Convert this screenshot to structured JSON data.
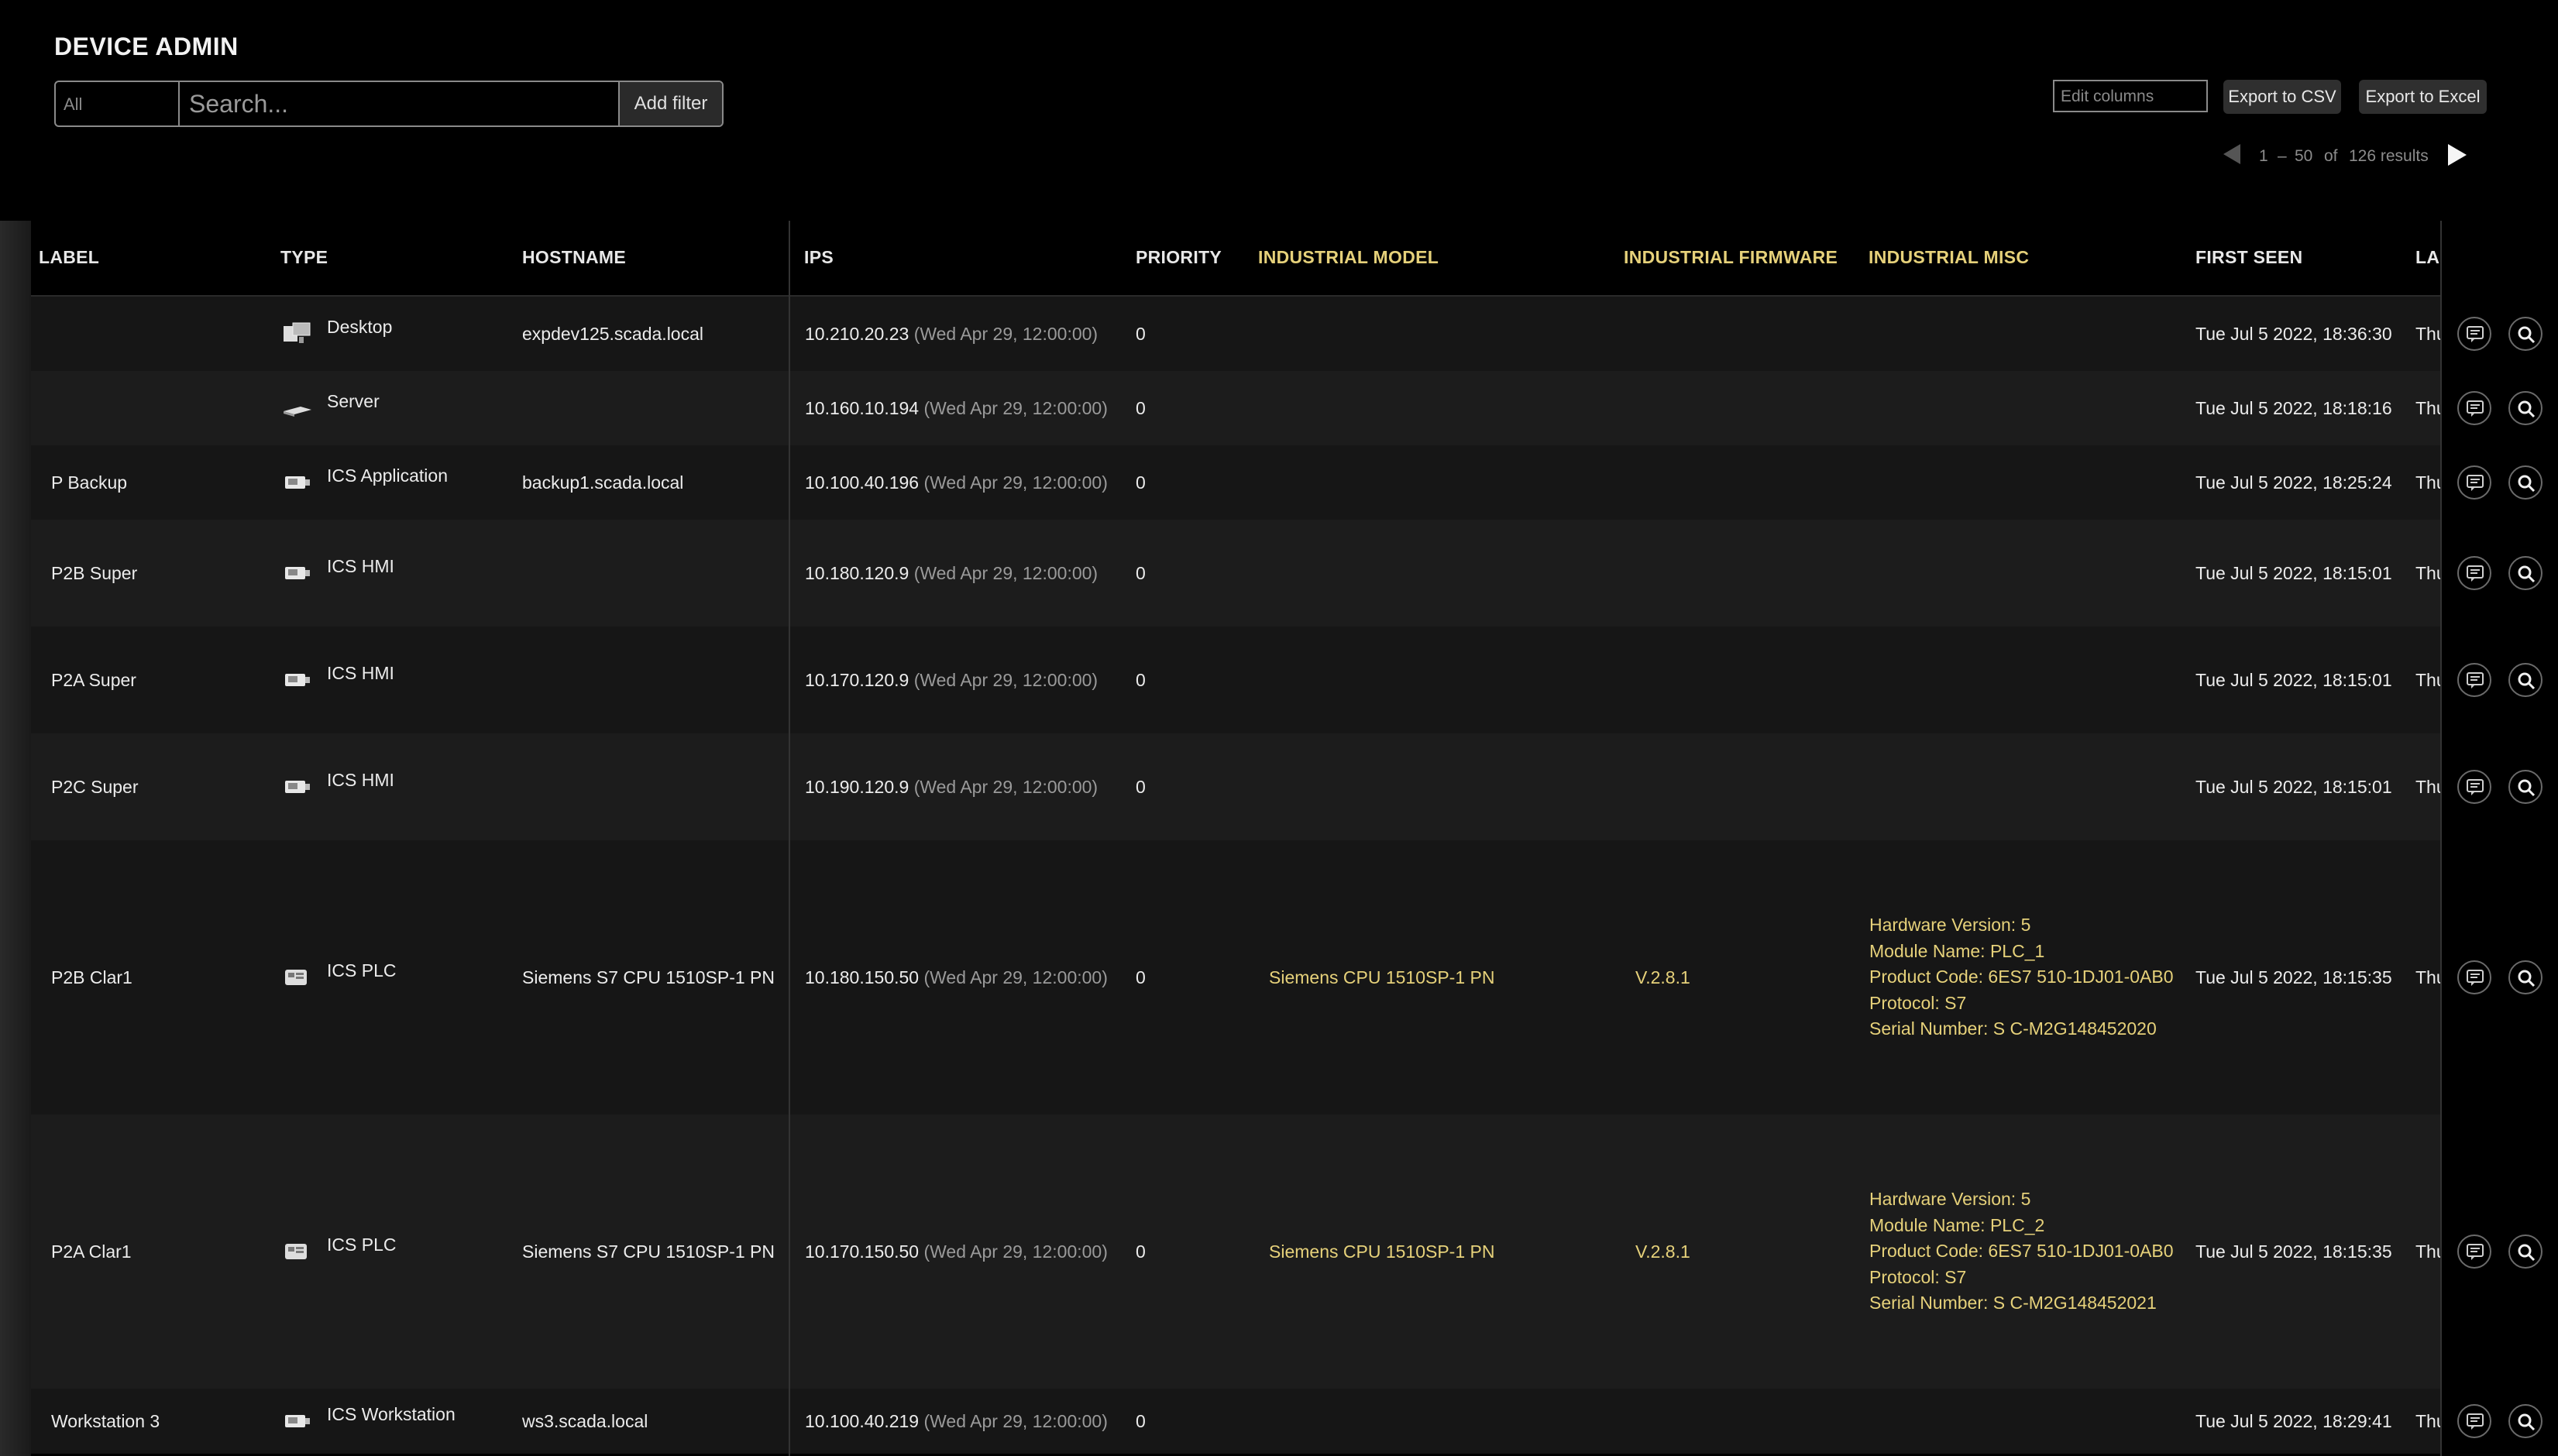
{
  "header": {
    "title": "DEVICE ADMIN",
    "filter_all": "All",
    "search_placeholder": "Search...",
    "add_filter": "Add filter",
    "edit_columns": "Edit columns",
    "export_csv": "Export to CSV",
    "export_excel": "Export to Excel"
  },
  "pagination": {
    "start": "1",
    "dash": "–",
    "end": "50",
    "of": "of",
    "total": "126 results"
  },
  "colors": {
    "industrial_accent": "#e6d17a",
    "background": "#000000",
    "row_a": "#161616",
    "row_b": "#1c1c1c"
  },
  "columns": [
    "LABEL",
    "TYPE",
    "HOSTNAME",
    "IPS",
    "PRIORITY",
    "INDUSTRIAL MODEL",
    "INDUSTRIAL FIRMWARE",
    "INDUSTRIAL MISC",
    "FIRST SEEN",
    "LA"
  ],
  "rows": [
    {
      "label": "",
      "type": "Desktop",
      "icon": "desktop-icon",
      "hostname": "expdev125.scada.local",
      "ip": "10.210.20.23",
      "ip_time": "(Wed Apr 29, 12:00:00)",
      "priority": "0",
      "model": "",
      "firmware": "",
      "misc": [],
      "first_seen": "Tue Jul 5 2022, 18:36:30",
      "last": "Thu"
    },
    {
      "label": "",
      "type": "Server",
      "icon": "server-icon",
      "hostname": "",
      "ip": "10.160.10.194",
      "ip_time": "(Wed Apr 29, 12:00:00)",
      "priority": "0",
      "model": "",
      "firmware": "",
      "misc": [],
      "first_seen": "Tue Jul 5 2022, 18:18:16",
      "last": "Thu"
    },
    {
      "label": "P Backup",
      "type": "ICS Application",
      "icon": "ics-device-icon",
      "hostname": "backup1.scada.local",
      "ip": "10.100.40.196",
      "ip_time": "(Wed Apr 29, 12:00:00)",
      "priority": "0",
      "model": "",
      "firmware": "",
      "misc": [],
      "first_seen": "Tue Jul 5 2022, 18:25:24",
      "last": "Thu"
    },
    {
      "label": "P2B Super",
      "type": "ICS HMI",
      "icon": "ics-device-icon",
      "hostname": "",
      "ip": "10.180.120.9",
      "ip_time": "(Wed Apr 29, 12:00:00)",
      "priority": "0",
      "model": "",
      "firmware": "",
      "misc": [],
      "first_seen": "Tue Jul 5 2022, 18:15:01",
      "last": "Thu"
    },
    {
      "label": "P2A Super",
      "type": "ICS HMI",
      "icon": "ics-device-icon",
      "hostname": "",
      "ip": "10.170.120.9",
      "ip_time": "(Wed Apr 29, 12:00:00)",
      "priority": "0",
      "model": "",
      "firmware": "",
      "misc": [],
      "first_seen": "Tue Jul 5 2022, 18:15:01",
      "last": "Thu"
    },
    {
      "label": "P2C Super",
      "type": "ICS HMI",
      "icon": "ics-device-icon",
      "hostname": "",
      "ip": "10.190.120.9",
      "ip_time": "(Wed Apr 29, 12:00:00)",
      "priority": "0",
      "model": "",
      "firmware": "",
      "misc": [],
      "first_seen": "Tue Jul 5 2022, 18:15:01",
      "last": "Thu"
    },
    {
      "label": "P2B Clar1",
      "type": "ICS PLC",
      "icon": "plc-icon",
      "hostname": "Siemens S7 CPU 1510SP-1 PN",
      "ip": "10.180.150.50",
      "ip_time": "(Wed Apr 29, 12:00:00)",
      "priority": "0",
      "model": "Siemens CPU 1510SP-1 PN",
      "firmware": "V.2.8.1",
      "misc": [
        "Hardware Version: 5",
        "Module Name: PLC_1",
        "Product Code: 6ES7 510-1DJ01-0AB0",
        "Protocol: S7",
        "Serial Number: S C-M2G148452020"
      ],
      "first_seen": "Tue Jul 5 2022, 18:15:35",
      "last": "Thu"
    },
    {
      "label": "P2A Clar1",
      "type": "ICS PLC",
      "icon": "plc-icon",
      "hostname": "Siemens S7 CPU 1510SP-1 PN",
      "ip": "10.170.150.50",
      "ip_time": "(Wed Apr 29, 12:00:00)",
      "priority": "0",
      "model": "Siemens CPU 1510SP-1 PN",
      "firmware": "V.2.8.1",
      "misc": [
        "Hardware Version: 5",
        "Module Name: PLC_2",
        "Product Code: 6ES7 510-1DJ01-0AB0",
        "Protocol: S7",
        "Serial Number: S C-M2G148452021"
      ],
      "first_seen": "Tue Jul 5 2022, 18:15:35",
      "last": "Thu"
    },
    {
      "label": "Workstation 3",
      "type": "ICS Workstation",
      "icon": "ics-device-icon",
      "hostname": "ws3.scada.local",
      "ip": "10.100.40.219",
      "ip_time": "(Wed Apr 29, 12:00:00)",
      "priority": "0",
      "model": "",
      "firmware": "",
      "misc": [],
      "first_seen": "Tue Jul 5 2022, 18:29:41",
      "last": "Thu"
    }
  ]
}
